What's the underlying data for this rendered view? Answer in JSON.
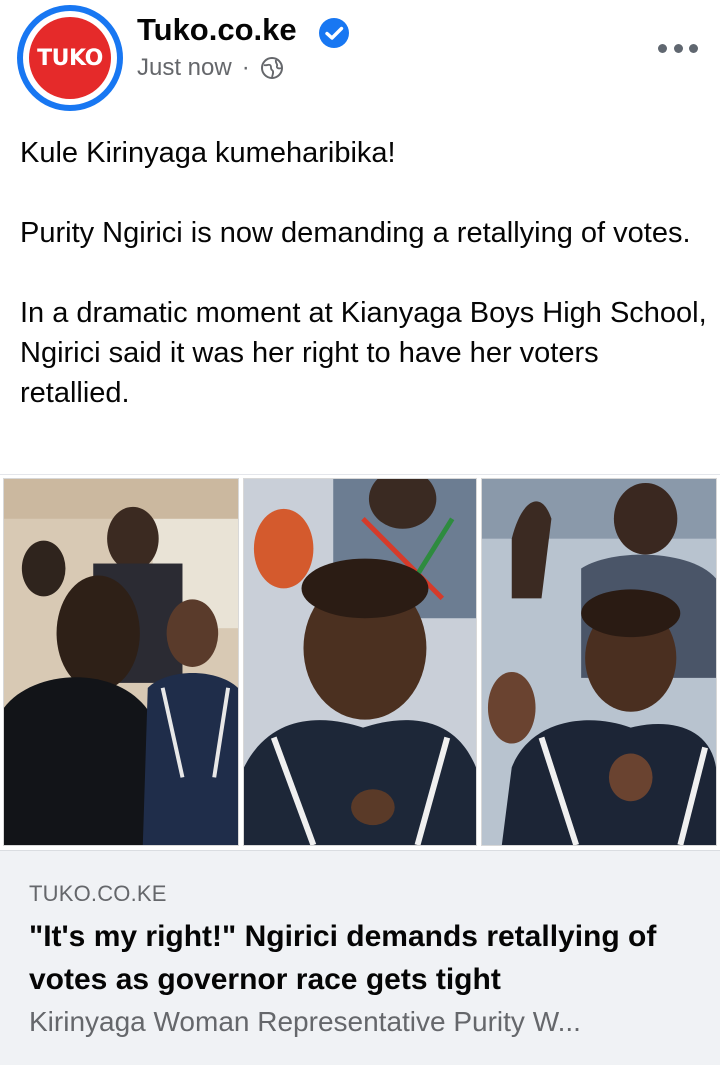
{
  "post": {
    "page_name": "Tuko.co.ke",
    "avatar_text": "TUKO",
    "timestamp": "Just now",
    "separator": "·",
    "verified": true,
    "privacy_icon": "globe-icon",
    "more_icon": "more-options-icon",
    "paragraphs": [
      "Kule Kirinyaga kumeharibika!",
      "Purity Ngirici is now demanding a retallying of votes.",
      "In a dramatic moment at Kianyaga Boys High School, Ngirici said it was her right to have her voters retallied."
    ]
  },
  "link_preview": {
    "domain": "TUKO.CO.KE",
    "title": "\"It's my right!\" Ngirici demands retallying of votes as governor race gets tight",
    "description": "Kirinyaga Woman Representative Purity W..."
  },
  "colors": {
    "brand_red": "#e52a2a",
    "verified_blue": "#1877f2",
    "secondary_text": "#65676b",
    "preview_bg": "#f0f2f5"
  }
}
